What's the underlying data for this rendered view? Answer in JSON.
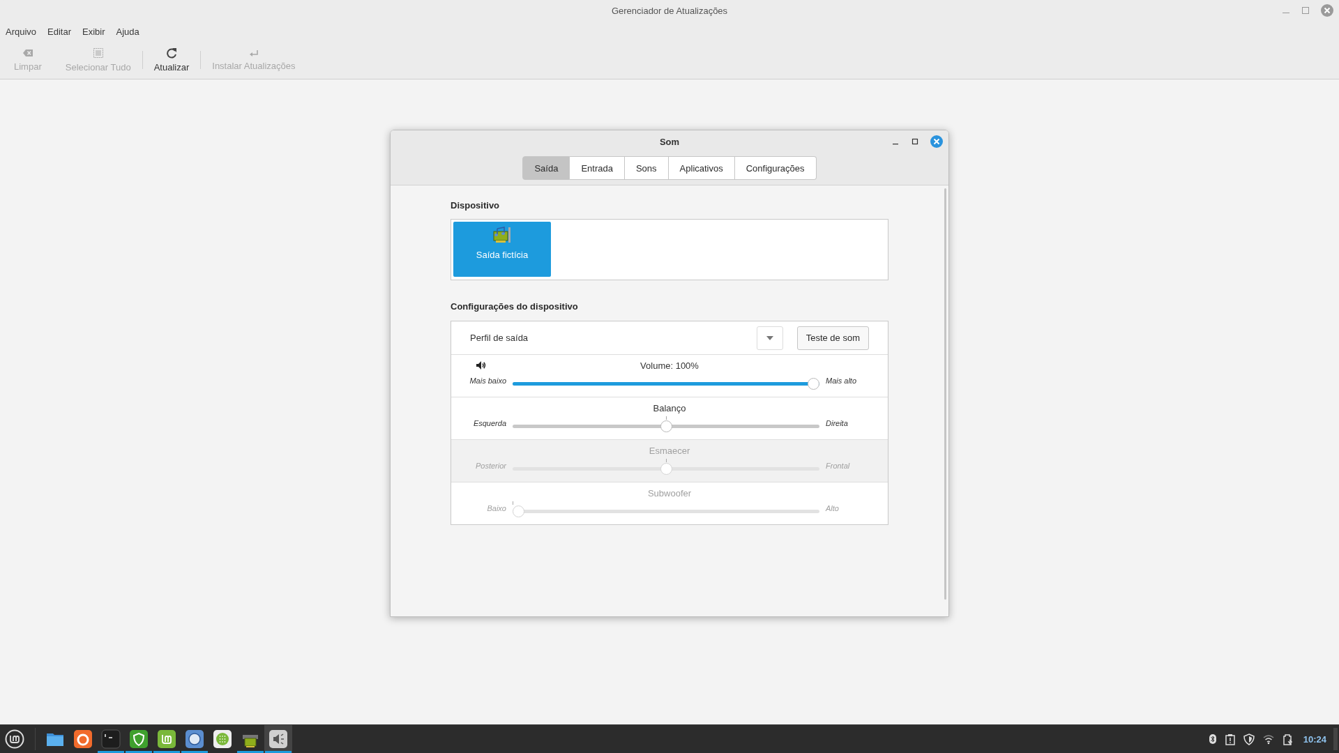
{
  "window": {
    "title": "Gerenciador de Atualizações"
  },
  "menu": [
    "Arquivo",
    "Editar",
    "Exibir",
    "Ajuda"
  ],
  "toolbar": [
    {
      "kind": "clear",
      "label": "Limpar",
      "disabled": true
    },
    {
      "kind": "select_all",
      "label": "Selecionar Tudo",
      "disabled": true
    },
    {
      "kind": "separator"
    },
    {
      "kind": "refresh",
      "label": "Atualizar",
      "disabled": false
    },
    {
      "kind": "separator"
    },
    {
      "kind": "install",
      "label": "Instalar Atualizações",
      "disabled": true
    }
  ],
  "dialog": {
    "title": "Som",
    "tabs": [
      {
        "label": "Saída",
        "selected": true
      },
      {
        "label": "Entrada",
        "selected": false
      },
      {
        "label": "Sons",
        "selected": false
      },
      {
        "label": "Aplicativos",
        "selected": false
      },
      {
        "label": "Configurações",
        "selected": false
      }
    ],
    "device_heading": "Dispositivo",
    "devices": [
      {
        "label": "Saída fictícia",
        "selected": true
      }
    ],
    "settings_heading": "Configurações do dispositivo",
    "profile_label": "Perfil de saída",
    "test_button": "Teste de som",
    "sliders": [
      {
        "kind": "volume",
        "title": "Volume: 100%",
        "min_label": "Mais baixo",
        "max_label": "Mais alto",
        "level": 1,
        "disabled": false,
        "highlighted": false
      },
      {
        "kind": "marked",
        "title": "Balanço",
        "min_label": "Esquerda",
        "max_label": "Direita",
        "level": 0.5,
        "disabled": false,
        "highlighted": false
      },
      {
        "kind": "marked",
        "title": "Esmaecer",
        "min_label": "Posterior",
        "max_label": "Frontal",
        "level": 0.5,
        "disabled": true,
        "highlighted": true
      },
      {
        "kind": "marked",
        "title": "Subwoofer",
        "min_label": "Baixo",
        "max_label": "Alto",
        "level": 0,
        "disabled": true,
        "highlighted": false
      }
    ]
  },
  "taskbar": {
    "apps": [
      {
        "kind": "files",
        "running": false,
        "active": false
      },
      {
        "kind": "firefox",
        "running": false,
        "active": false
      },
      {
        "kind": "terminal",
        "running": true,
        "active": false
      },
      {
        "kind": "shield",
        "running": true,
        "active": false
      },
      {
        "kind": "mint",
        "running": true,
        "active": false
      },
      {
        "kind": "browser",
        "running": true,
        "active": false
      },
      {
        "kind": "grid",
        "running": false,
        "active": false
      },
      {
        "kind": "card",
        "running": true,
        "active": false
      },
      {
        "kind": "sound",
        "running": true,
        "active": true
      }
    ],
    "tray": [
      {
        "kind": "bluetooth"
      },
      {
        "kind": "clipboard"
      },
      {
        "kind": "shield"
      },
      {
        "kind": "wifi"
      },
      {
        "kind": "battery"
      }
    ],
    "clock": "10:24"
  }
}
